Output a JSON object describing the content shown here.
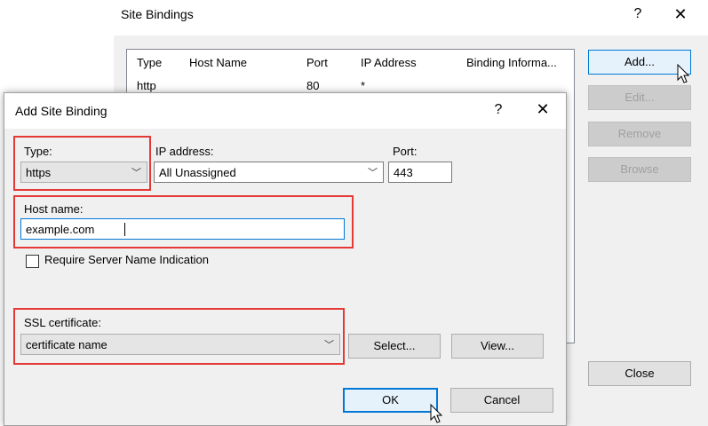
{
  "site_bindings": {
    "title": "Site Bindings",
    "help_glyph": "?",
    "close_glyph": "✕",
    "columns": [
      "Type",
      "Host Name",
      "Port",
      "IP Address",
      "Binding Informa..."
    ],
    "rows": [
      {
        "type": "http",
        "host": "",
        "port": "80",
        "ip": "*",
        "info": ""
      }
    ],
    "buttons": {
      "add": "Add...",
      "edit": "Edit...",
      "remove": "Remove",
      "browse": "Browse",
      "close": "Close"
    }
  },
  "add_dialog": {
    "title": "Add Site Binding",
    "help_glyph": "?",
    "close_glyph": "✕",
    "type_label": "Type:",
    "type_value": "https",
    "ip_label": "IP address:",
    "ip_value": "All Unassigned",
    "port_label": "Port:",
    "port_value": "443",
    "host_label": "Host name:",
    "host_value": "example.com",
    "sni_label": "Require Server Name Indication",
    "sni_checked": false,
    "ssl_label": "SSL certificate:",
    "ssl_value": "certificate name",
    "select_label": "Select...",
    "view_label": "View...",
    "ok_label": "OK",
    "cancel_label": "Cancel"
  },
  "colors": {
    "highlight": "#e53935",
    "accent": "#0078d7",
    "disabled_text": "#a0a0a0"
  },
  "icons": [
    "help-icon",
    "close-icon",
    "chevron-down-icon",
    "mouse-pointer-icon"
  ]
}
